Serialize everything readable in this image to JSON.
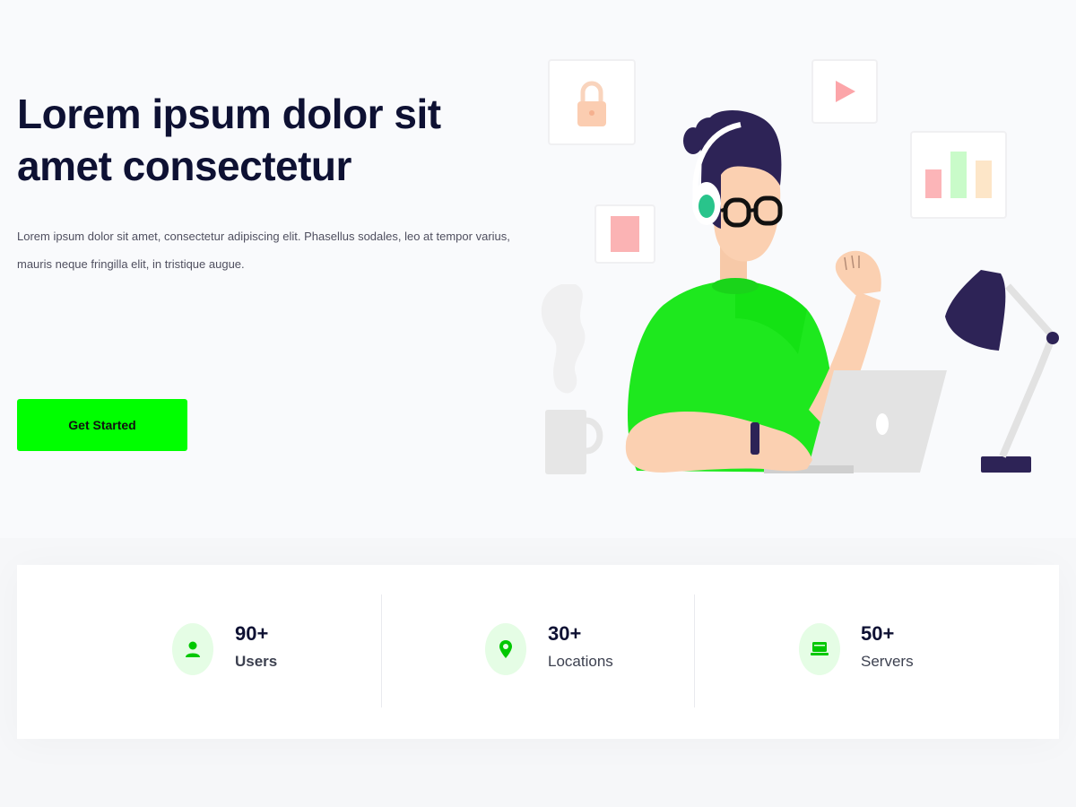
{
  "hero": {
    "title": "Lorem ipsum dolor sit amet consectetur",
    "description": "Lorem ipsum dolor sit amet, consectetur adipiscing elit. Phasellus sodales, leo at tempor varius, mauris neque fringilla elit, in tristique augue.",
    "cta_label": "Get Started"
  },
  "colors": {
    "accent": "#00ff00",
    "title": "#0e1133",
    "icon_bg": "#e5fde5",
    "hair": "#2d2356"
  },
  "stats": [
    {
      "value": "90+",
      "label": "Users",
      "icon": "user-icon"
    },
    {
      "value": "30+",
      "label": "Locations",
      "icon": "map-pin-icon"
    },
    {
      "value": "50+",
      "label": "Servers",
      "icon": "server-icon"
    }
  ]
}
